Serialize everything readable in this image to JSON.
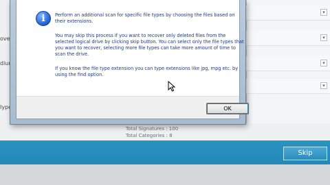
{
  "background": {
    "left_fragments": [
      "overy",
      "dium",
      "Iype"
    ],
    "stats": {
      "total_signatures": "Total Signatures : 100",
      "total_categories": "Total Categories : 8"
    },
    "skip_button_label": "Skip"
  },
  "dialog": {
    "icon": "info-icon",
    "paragraph_1": "Perform an additional scan for specific file types by choosing the files based on their extensions.",
    "paragraph_2": "You may skip this process if you want to recover only deleted files from the selected logical drive by clicking skip button. You can select only the file types that you want to recover, selecting more file types can take more amount of time to scan the drive.",
    "paragraph_3": "If you know the file type extension you can type extensions like jpg, mpg etc. by using the find option.",
    "ok_label": "OK"
  },
  "colors": {
    "accent_bar": "#2a93c2",
    "message_text": "#1b3a86"
  }
}
